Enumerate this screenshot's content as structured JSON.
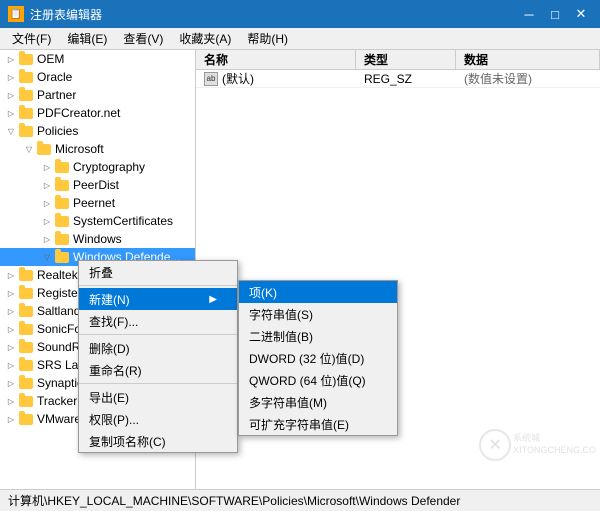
{
  "title_bar": {
    "icon": "📋",
    "title": "注册表编辑器",
    "minimize_label": "─",
    "maximize_label": "□",
    "close_label": "✕"
  },
  "menu_bar": {
    "items": [
      {
        "label": "文件(F)"
      },
      {
        "label": "编辑(E)"
      },
      {
        "label": "查看(V)"
      },
      {
        "label": "收藏夹(A)"
      },
      {
        "label": "帮助(H)"
      }
    ]
  },
  "tree": {
    "items": [
      {
        "label": "OEM",
        "indent": 0,
        "expanded": false,
        "selected": false
      },
      {
        "label": "Oracle",
        "indent": 0,
        "expanded": false,
        "selected": false
      },
      {
        "label": "Partner",
        "indent": 0,
        "expanded": false,
        "selected": false
      },
      {
        "label": "PDFCreator.net",
        "indent": 0,
        "expanded": false,
        "selected": false
      },
      {
        "label": "Policies",
        "indent": 0,
        "expanded": true,
        "selected": false
      },
      {
        "label": "Microsoft",
        "indent": 1,
        "expanded": true,
        "selected": false
      },
      {
        "label": "Cryptography",
        "indent": 2,
        "expanded": false,
        "selected": false
      },
      {
        "label": "PeerDist",
        "indent": 2,
        "expanded": false,
        "selected": false
      },
      {
        "label": "Peernet",
        "indent": 2,
        "expanded": false,
        "selected": false
      },
      {
        "label": "SystemCertificates",
        "indent": 2,
        "expanded": false,
        "selected": false
      },
      {
        "label": "Windows",
        "indent": 2,
        "expanded": false,
        "selected": false
      },
      {
        "label": "Windows Defender",
        "indent": 2,
        "expanded": true,
        "selected": true
      },
      {
        "label": "Realtek",
        "indent": 0,
        "expanded": false,
        "selected": false
      },
      {
        "label": "RegisteredApplicati...",
        "indent": 0,
        "expanded": false,
        "selected": false
      },
      {
        "label": "Saltland...",
        "indent": 0,
        "expanded": false,
        "selected": false
      },
      {
        "label": "SonicFo...",
        "indent": 0,
        "expanded": false,
        "selected": false
      },
      {
        "label": "SoundRe...",
        "indent": 0,
        "expanded": false,
        "selected": false
      },
      {
        "label": "SRS Lab...",
        "indent": 0,
        "expanded": false,
        "selected": false
      },
      {
        "label": "Synaptic...",
        "indent": 0,
        "expanded": false,
        "selected": false
      },
      {
        "label": "Tracker Software",
        "indent": 0,
        "expanded": false,
        "selected": false
      },
      {
        "label": "VMware, Inc.",
        "indent": 0,
        "expanded": false,
        "selected": false
      }
    ]
  },
  "columns": {
    "name": "名称",
    "type": "类型",
    "data": "数据"
  },
  "registry_entries": [
    {
      "name": "(默认)",
      "type": "REG_SZ",
      "data": "(数值未设置)",
      "icon": "ab"
    }
  ],
  "context_menu": {
    "items": [
      {
        "label": "折叠",
        "id": "collapse",
        "enabled": true,
        "submenu": false
      },
      {
        "label": "新建(N)",
        "id": "new",
        "enabled": true,
        "submenu": true,
        "highlighted": true
      },
      {
        "label": "查找(F)...",
        "id": "find",
        "enabled": true,
        "submenu": false
      },
      {
        "label": "删除(D)",
        "id": "delete",
        "enabled": true,
        "submenu": false
      },
      {
        "label": "重命名(R)",
        "id": "rename",
        "enabled": true,
        "submenu": false
      },
      {
        "label": "导出(E)",
        "id": "export",
        "enabled": true,
        "submenu": false
      },
      {
        "label": "权限(P)...",
        "id": "permissions",
        "enabled": true,
        "submenu": false
      },
      {
        "label": "复制项名称(C)",
        "id": "copy",
        "enabled": true,
        "submenu": false
      }
    ],
    "separator_after": [
      "collapse",
      "find",
      "rename"
    ]
  },
  "submenu": {
    "items": [
      {
        "label": "项(K)",
        "selected": true
      },
      {
        "label": "字符串值(S)",
        "selected": false
      },
      {
        "label": "二进制值(B)",
        "selected": false
      },
      {
        "label": "DWORD (32 位)值(D)",
        "selected": false
      },
      {
        "label": "QWORD (64 位)值(Q)",
        "selected": false
      },
      {
        "label": "多字符串值(M)",
        "selected": false
      },
      {
        "label": "可扩充字符串值(E)",
        "selected": false
      }
    ]
  },
  "status_bar": {
    "text": "计算机\\HKEY_LOCAL_MACHINE\\SOFTWARE\\Policies\\Microsoft\\Windows Defender"
  }
}
